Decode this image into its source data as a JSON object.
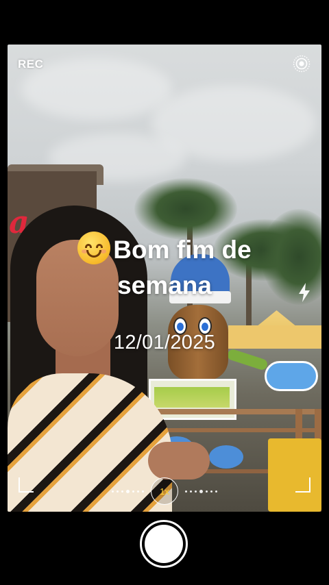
{
  "status": {
    "rec_label": "REC"
  },
  "icons": {
    "live": "live-photo-icon",
    "flash": "flash-icon",
    "shutter": "shutter-button",
    "emoji": "smiling-face-emoji"
  },
  "overlay": {
    "caption_line1": "Bom fim de",
    "caption_line2": "semana",
    "date": "12/01/2025"
  },
  "zoom": {
    "label": "1x"
  },
  "colors": {
    "zoom_accent": "#ffd23a",
    "background": "#000000"
  }
}
